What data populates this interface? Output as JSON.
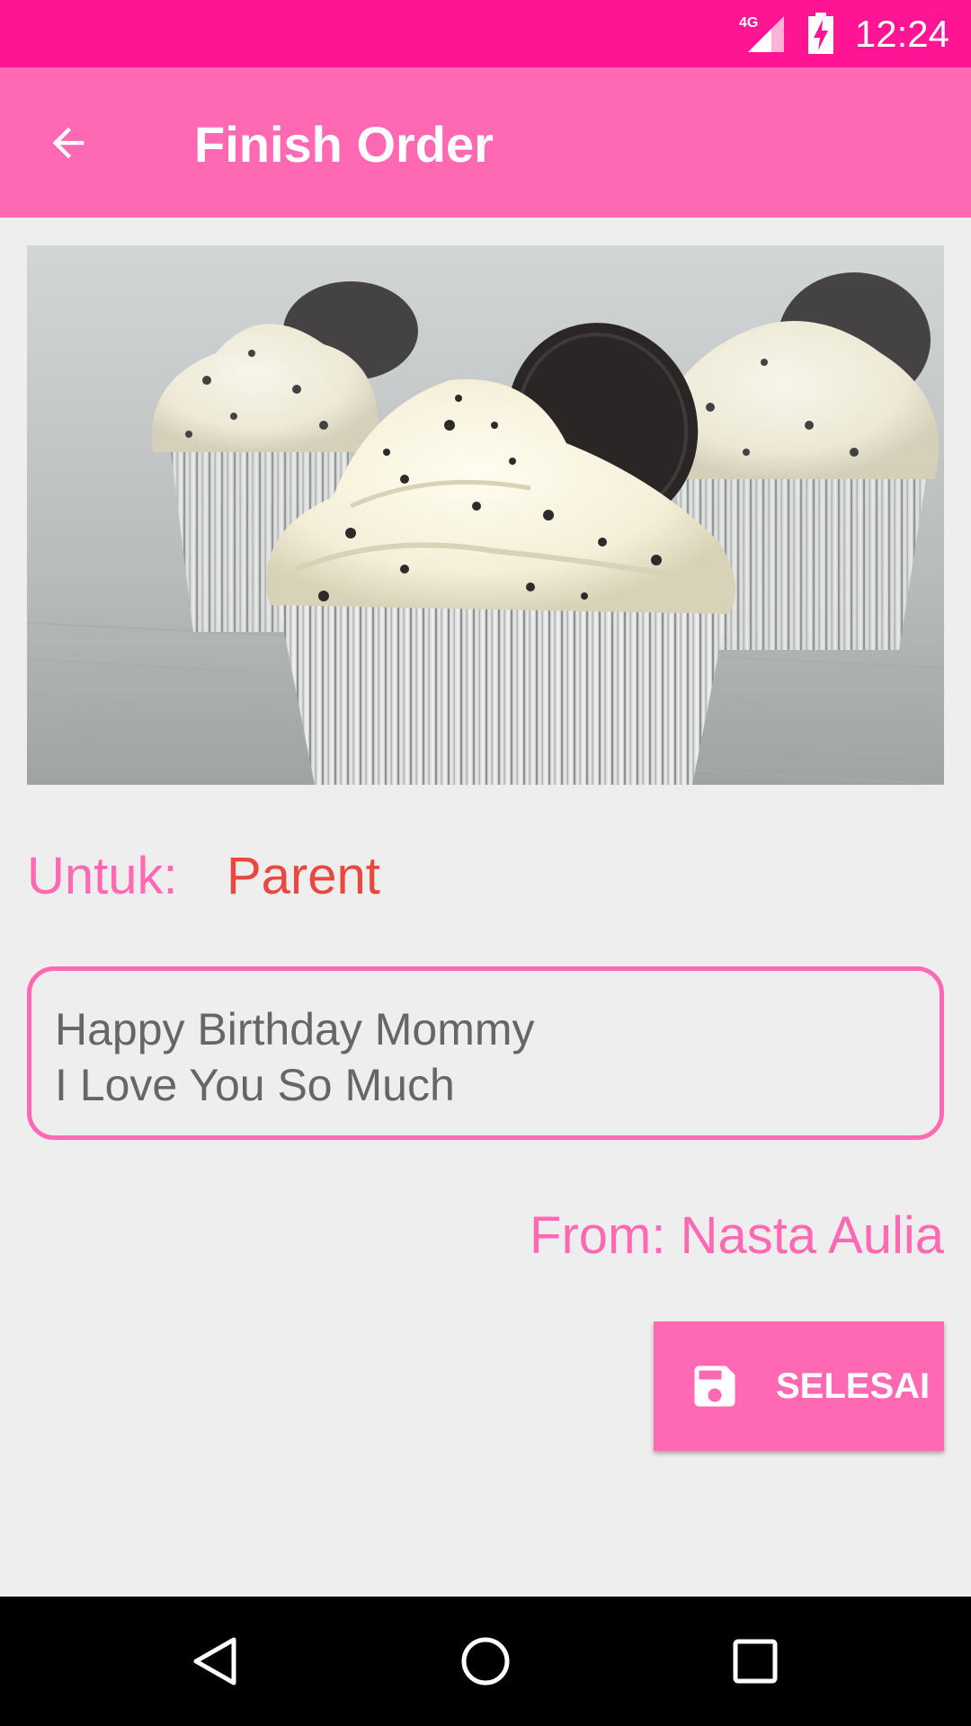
{
  "status_bar": {
    "network": "4G",
    "time": "12:24"
  },
  "app_bar": {
    "title": "Finish Order"
  },
  "recipient": {
    "label": "Untuk:",
    "value": "Parent"
  },
  "message": {
    "lines": [
      "Happy Birthday Mommy",
      "I Love You So Much"
    ]
  },
  "sender": {
    "text": "From: Nasta Aulia"
  },
  "finish_button": {
    "label": "SELESAI"
  },
  "icons": {
    "back": "back-arrow-icon",
    "save": "save-icon",
    "nav_back": "nav-back-icon",
    "nav_home": "nav-home-icon",
    "nav_recents": "nav-recents-icon"
  },
  "colors": {
    "status_bar": "#ff1493",
    "app_bar": "#ff69b4",
    "accent": "#ff69b4",
    "recipient_value": "#e8483d",
    "message_text": "#666666"
  }
}
